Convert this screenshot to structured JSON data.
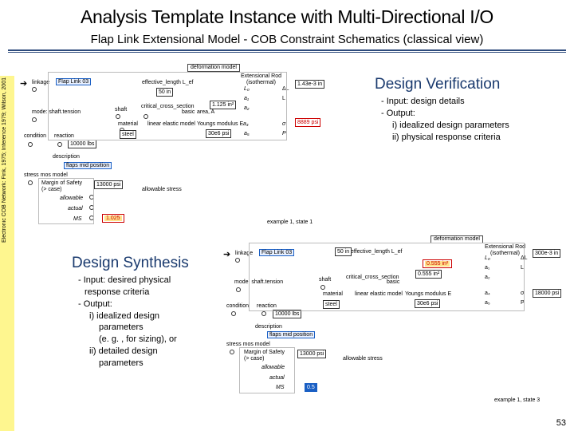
{
  "title": "Analysis Template Instance with Multi-Directional I/O",
  "subtitle": "Flap Link Extensional Model - COB Constraint Schematics (classical view)",
  "sidebar": "Electronic COB Network: Fink, 1975; Inference 1979; Wilson, 2001",
  "pagenum": "53",
  "top": {
    "zone": "deformation model",
    "linkage": "linkage",
    "flaplink": "Flap Link 03",
    "eff_length": "50 in",
    "eff_length_label": "effective_length L_ef",
    "ext_rod": "Extensional Rod\\n(isothermal)",
    "deltaL": "1.43e-3 in",
    "area": "1.125 in²",
    "E": "30e6 psi",
    "stress": "8889 psi",
    "force": "10000 lbs",
    "mode": "mode: shaft.tension",
    "shaft": "shaft",
    "crit": "critical_cross_section",
    "basic": "basic",
    "lem": "linear elastic model",
    "material": "material",
    "steel": "steel",
    "youngs": "Youngs modulus E",
    "cond": "condition",
    "react": "reaction",
    "desc": "description",
    "frp": "flaps mid position",
    "sms": "stress mos model",
    "mos": "Margin of Safety\\n(> case)",
    "mosval": "13000 psi",
    "allow": "allowable stress",
    "allowable": "allowable",
    "actual": "actual",
    "MS": "MS",
    "msval": "1.025",
    "ex": "example 1, state 1"
  },
  "dv": {
    "heading": "Design Verification",
    "l1": "- Input: design details",
    "l2": "- Output:",
    "l3": "i) idealized design parameters",
    "l4": "ii) physical response criteria"
  },
  "ds": {
    "heading": "Design Synthesis",
    "l1": "- Input: desired physical",
    "l1b": "response criteria",
    "l2": "- Output:",
    "l3": "i) idealized design",
    "l3b": "parameters",
    "l3c": "(e. g. , for sizing), or",
    "l4": "ii) detailed design",
    "l4b": "parameters"
  },
  "bot": {
    "zone": "deformation model",
    "eff_length": "50 in",
    "deltaL": "300e-3 in",
    "area": "0.555 in²",
    "stress": "18000 psi",
    "force": "10000 lbs",
    "mosval": "13000 psi",
    "msval": "0.5",
    "ex": "example 1, state 3"
  }
}
